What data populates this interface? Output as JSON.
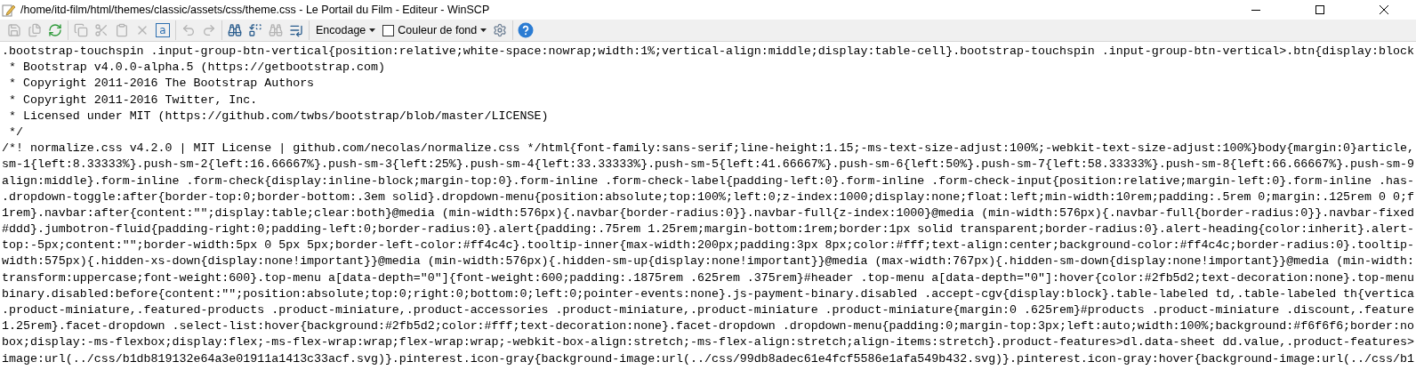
{
  "window": {
    "title": "/home/itd-film/html/themes/classic/assets/css/theme.css - Le Portail du Film - Editeur - WinSCP"
  },
  "toolbar": {
    "groups": [
      [
        {
          "kind": "save",
          "disabled": true
        },
        {
          "kind": "save-all",
          "disabled": true
        },
        {
          "kind": "reload",
          "disabled": false
        }
      ],
      [
        {
          "kind": "copy",
          "disabled": true
        },
        {
          "kind": "cut",
          "disabled": true
        },
        {
          "kind": "paste",
          "disabled": true
        },
        {
          "kind": "delete",
          "disabled": true
        },
        {
          "kind": "select-all",
          "label": "a",
          "disabled": false
        }
      ],
      [
        {
          "kind": "undo",
          "disabled": true
        },
        {
          "kind": "redo",
          "disabled": true
        }
      ],
      [
        {
          "kind": "find",
          "disabled": false
        },
        {
          "kind": "replace",
          "disabled": false
        },
        {
          "kind": "find-next",
          "disabled": true
        },
        {
          "kind": "goto",
          "disabled": false
        }
      ],
      [
        {
          "kind": "dropdown",
          "label": "Encodage"
        },
        {
          "kind": "checkbox",
          "label": "Couleur de fond",
          "checked": false
        },
        {
          "kind": "settings",
          "disabled": false
        }
      ],
      [
        {
          "kind": "help",
          "disabled": false
        }
      ]
    ]
  },
  "editor": {
    "lines": [
      ".bootstrap-touchspin .input-group-btn-vertical{position:relative;white-space:nowrap;width:1%;vertical-align:middle;display:table-cell}.bootstrap-touchspin .input-group-btn-vertical>.btn{display:block",
      " * Bootstrap v4.0.0-alpha.5 (https://getbootstrap.com)",
      " * Copyright 2011-2016 The Bootstrap Authors",
      " * Copyright 2011-2016 Twitter, Inc.",
      " * Licensed under MIT (https://github.com/twbs/bootstrap/blob/master/LICENSE)",
      " */",
      "/*! normalize.css v4.2.0 | MIT License | github.com/necolas/normalize.css */html{font-family:sans-serif;line-height:1.15;-ms-text-size-adjust:100%;-webkit-text-size-adjust:100%}body{margin:0}article,",
      "sm-1{left:8.33333%}.push-sm-2{left:16.66667%}.push-sm-3{left:25%}.push-sm-4{left:33.33333%}.push-sm-5{left:41.66667%}.push-sm-6{left:50%}.push-sm-7{left:58.33333%}.push-sm-8{left:66.66667%}.push-sm-9",
      "align:middle}.form-inline .form-check{display:inline-block;margin-top:0}.form-inline .form-check-label{padding-left:0}.form-inline .form-check-input{position:relative;margin-left:0}.form-inline .has-",
      ".dropdown-toggle:after{border-top:0;border-bottom:.3em solid}.dropdown-menu{position:absolute;top:100%;left:0;z-index:1000;display:none;float:left;min-width:10rem;padding:.5rem 0;margin:.125rem 0 0;f",
      "1rem}.navbar:after{content:\"\";display:table;clear:both}@media (min-width:576px){.navbar{border-radius:0}}.navbar-full{z-index:1000}@media (min-width:576px){.navbar-full{border-radius:0}}.navbar-fixed",
      "#ddd}.jumbotron-fluid{padding-right:0;padding-left:0;border-radius:0}.alert{padding:.75rem 1.25rem;margin-bottom:1rem;border:1px solid transparent;border-radius:0}.alert-heading{color:inherit}.alert-",
      "top:-5px;content:\"\";border-width:5px 0 5px 5px;border-left-color:#ff4c4c}.tooltip-inner{max-width:200px;padding:3px 8px;color:#fff;text-align:center;background-color:#ff4c4c;border-radius:0}.tooltip-",
      "width:575px){.hidden-xs-down{display:none!important}}@media (min-width:576px){.hidden-sm-up{display:none!important}}@media (max-width:767px){.hidden-sm-down{display:none!important}}@media (min-width:",
      "transform:uppercase;font-weight:600}.top-menu a[data-depth=\"0\"]{font-weight:600;padding:.1875rem .625rem .375rem}#header .top-menu a[data-depth=\"0\"]:hover{color:#2fb5d2;text-decoration:none}.top-menu",
      "binary.disabled:before{content:\"\";position:absolute;top:0;right:0;bottom:0;left:0;pointer-events:none}.js-payment-binary.disabled .accept-cgv{display:block}.table-labeled td,.table-labeled th{vertica",
      ".product-miniature,.featured-products .product-miniature,.product-accessories .product-miniature,.product-miniature .product-miniature{margin:0 .625rem}#products .product-miniature .discount,.feature",
      "1.25rem}.facet-dropdown .select-list:hover{background:#2fb5d2;color:#fff;text-decoration:none}.facet-dropdown .dropdown-menu{padding:0;margin-top:3px;left:auto;width:100%;background:#f6f6f6;border:no",
      "box;display:-ms-flexbox;display:flex;-ms-flex-wrap:wrap;flex-wrap:wrap;-webkit-box-align:stretch;-ms-flex-align:stretch;align-items:stretch}.product-features>dl.data-sheet dd.value,.product-features>",
      "image:url(../css/b1db819132e64a3e01911a1413c33acf.svg)}.pinterest.icon-gray{background-image:url(../css/99db8adec61e4fcf5586e1afa549b432.svg)}.pinterest.icon-gray:hover{background-image:url(../css/b1"
    ]
  }
}
